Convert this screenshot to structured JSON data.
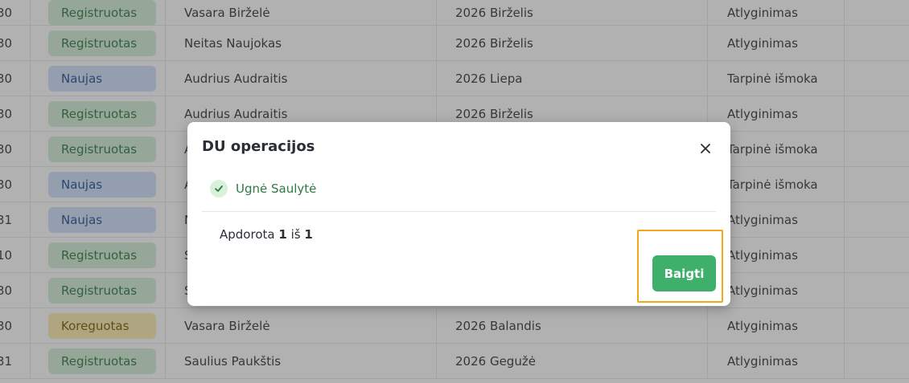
{
  "table": {
    "rows": [
      {
        "num": "30",
        "status": "Registruotas",
        "status_type": "reg",
        "name": "Vasara Birželė",
        "period": "2026 Birželis",
        "type": "Atlyginimas"
      },
      {
        "num": "30",
        "status": "Registruotas",
        "status_type": "reg",
        "name": "Neitas Naujokas",
        "period": "2026 Birželis",
        "type": "Atlyginimas"
      },
      {
        "num": "30",
        "status": "Naujas",
        "status_type": "new",
        "name": "Audrius Audraitis",
        "period": "2026 Liepa",
        "type": "Tarpinė išmoka"
      },
      {
        "num": "30",
        "status": "Registruotas",
        "status_type": "reg",
        "name": "Audrius Audraitis",
        "period": "2026 Birželis",
        "type": "Atlyginimas"
      },
      {
        "num": "30",
        "status": "Registruotas",
        "status_type": "reg",
        "name": "A",
        "period": "",
        "type": "Tarpinė išmoka"
      },
      {
        "num": "30",
        "status": "Naujas",
        "status_type": "new",
        "name": "A",
        "period": "",
        "type": "Tarpinė išmoka"
      },
      {
        "num": "31",
        "status": "Naujas",
        "status_type": "new",
        "name": "N",
        "period": "",
        "type": "Atlyginimas"
      },
      {
        "num": "10",
        "status": "Registruotas",
        "status_type": "reg",
        "name": "S",
        "period": "",
        "type": "Atlyginimas"
      },
      {
        "num": "30",
        "status": "Registruotas",
        "status_type": "reg",
        "name": "S",
        "period": "",
        "type": "Atlyginimas"
      },
      {
        "num": "30",
        "status": "Koreguotas",
        "status_type": "kor",
        "name": "Vasara Birželė",
        "period": "2026 Balandis",
        "type": "Atlyginimas"
      },
      {
        "num": "31",
        "status": "Registruotas",
        "status_type": "reg",
        "name": "Saulius Paukštis",
        "period": "2026 Gegužė",
        "type": "Atlyginimas"
      }
    ]
  },
  "modal": {
    "title": "DU operacijos",
    "close_icon": "close-icon",
    "item_label": "Ugnė Saulytė",
    "item_icon": "check-circle-icon",
    "progress_prefix": "Apdorota",
    "progress_done": "1",
    "progress_sep": "iš",
    "progress_total": "1",
    "finish_label": "Baigti"
  },
  "colors": {
    "accent_green": "#3fb06b",
    "highlight_border": "#f2a81d",
    "badge_registered": "#d2edd5",
    "badge_new": "#cfe0fb",
    "badge_corrected": "#fcebb0"
  }
}
